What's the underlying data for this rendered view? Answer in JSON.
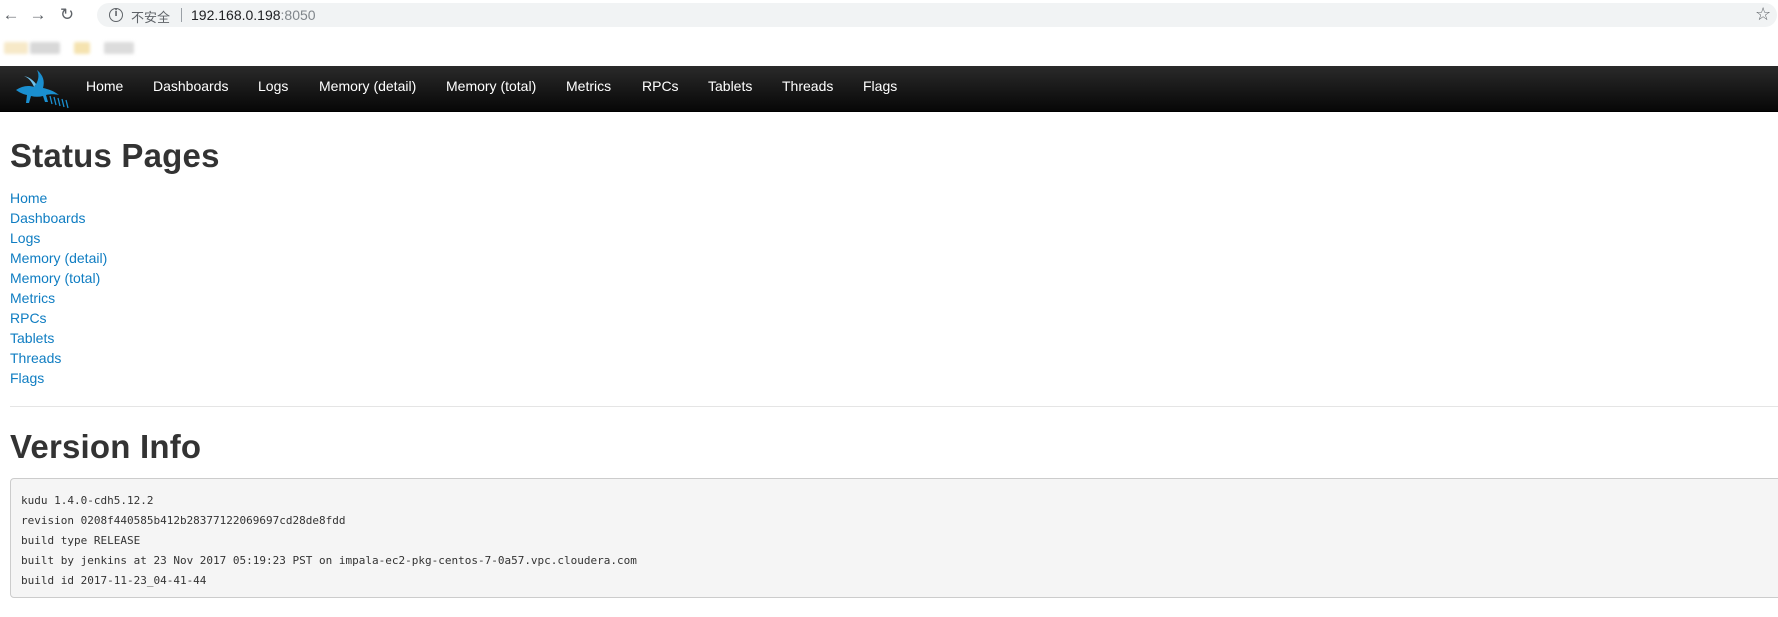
{
  "browser": {
    "back_icon": "back-arrow-icon",
    "forward_icon": "forward-arrow-icon",
    "reload_icon": "reload-icon",
    "info_icon": "info-icon",
    "security_label": "不安全",
    "url_host": "192.168.0.198",
    "url_port": ":8050",
    "bookmark_icon": "star-icon"
  },
  "navbar": {
    "logo": "kudu-antelope-logo",
    "links": [
      "Home",
      "Dashboards",
      "Logs",
      "Memory (detail)",
      "Memory (total)",
      "Metrics",
      "RPCs",
      "Tablets",
      "Threads",
      "Flags"
    ]
  },
  "status_pages": {
    "title": "Status Pages",
    "links": [
      "Home",
      "Dashboards",
      "Logs",
      "Memory (detail)",
      "Memory (total)",
      "Metrics",
      "RPCs",
      "Tablets",
      "Threads",
      "Flags"
    ]
  },
  "version_info": {
    "title": "Version Info",
    "lines": [
      "kudu 1.4.0-cdh5.12.2",
      "revision 0208f440585b412b28377122069697cd28de8fdd",
      "build type RELEASE",
      "built by jenkins at 23 Nov 2017 05:19:23 PST on impala-ec2-pkg-centos-7-0a57.vpc.cloudera.com",
      "build id 2017-11-23_04-41-44"
    ]
  },
  "colors": {
    "link": "#0f7dc2",
    "navbar_top": "#2a2a2a",
    "navbar_bottom": "#070707",
    "logo_blue": "#1a8fd0"
  }
}
